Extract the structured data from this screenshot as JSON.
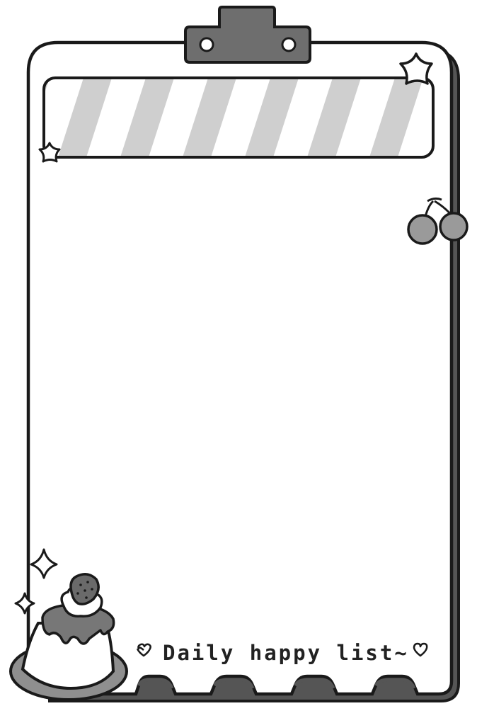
{
  "footer": {
    "caption": "Daily happy list~"
  },
  "decorations": {
    "top_clip": "clipboard-clip",
    "title_banner": "striped-banner",
    "corner_icons": [
      "star-icon",
      "star-icon",
      "cherry-icon",
      "pudding-icon",
      "sparkle-icon",
      "heart-icon"
    ]
  },
  "colors": {
    "outline": "#1a1a1a",
    "shadow": "#555555",
    "clip_fill": "#6e6e6e",
    "stripe": "#cfcfcf",
    "cherry": "#9a9a9a",
    "pudding_base": "#8f8f8f",
    "paper": "#ffffff"
  }
}
